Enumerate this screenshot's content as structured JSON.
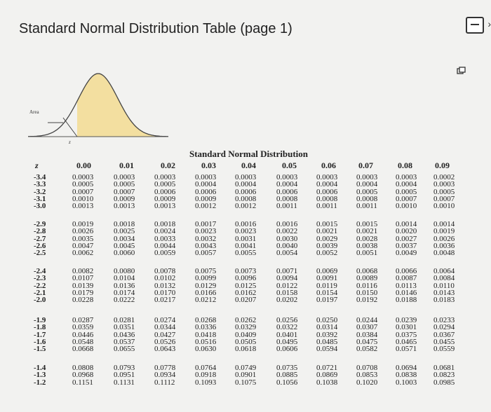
{
  "title": "Standard Normal Distribution Table (page 1)",
  "figure": {
    "area_label": "Area",
    "z_label": "z"
  },
  "table": {
    "title": "Standard Normal Distribution",
    "z_header": "z",
    "columns": [
      "0.00",
      "0.01",
      "0.02",
      "0.03",
      "0.04",
      "0.05",
      "0.06",
      "0.07",
      "0.08",
      "0.09"
    ],
    "groups": [
      {
        "z": [
          "-3.4",
          "-3.3",
          "-3.2",
          "-3.1",
          "-3.0"
        ],
        "cols": [
          [
            "0.0003",
            "0.0005",
            "0.0007",
            "0.0010",
            "0.0013"
          ],
          [
            "0.0003",
            "0.0005",
            "0.0007",
            "0.0009",
            "0.0013"
          ],
          [
            "0.0003",
            "0.0005",
            "0.0006",
            "0.0009",
            "0.0013"
          ],
          [
            "0.0003",
            "0.0004",
            "0.0006",
            "0.0009",
            "0.0012"
          ],
          [
            "0.0003",
            "0.0004",
            "0.0006",
            "0.0008",
            "0.0012"
          ],
          [
            "0.0003",
            "0.0004",
            "0.0006",
            "0.0008",
            "0.0011"
          ],
          [
            "0.0003",
            "0.0004",
            "0.0006",
            "0.0008",
            "0.0011"
          ],
          [
            "0.0003",
            "0.0004",
            "0.0005",
            "0.0008",
            "0.0011"
          ],
          [
            "0.0003",
            "0.0004",
            "0.0005",
            "0.0007",
            "0.0010"
          ],
          [
            "0.0002",
            "0.0003",
            "0.0005",
            "0.0007",
            "0.0010"
          ]
        ]
      },
      {
        "z": [
          "-2.9",
          "-2.8",
          "-2.7",
          "-2.6",
          "-2.5"
        ],
        "cols": [
          [
            "0.0019",
            "0.0026",
            "0.0035",
            "0.0047",
            "0.0062"
          ],
          [
            "0.0018",
            "0.0025",
            "0.0034",
            "0.0045",
            "0.0060"
          ],
          [
            "0.0018",
            "0.0024",
            "0.0033",
            "0.0044",
            "0.0059"
          ],
          [
            "0.0017",
            "0.0023",
            "0.0032",
            "0.0043",
            "0.0057"
          ],
          [
            "0.0016",
            "0.0023",
            "0.0031",
            "0.0041",
            "0.0055"
          ],
          [
            "0.0016",
            "0.0022",
            "0.0030",
            "0.0040",
            "0.0054"
          ],
          [
            "0.0015",
            "0.0021",
            "0.0029",
            "0.0039",
            "0.0052"
          ],
          [
            "0.0015",
            "0.0021",
            "0.0028",
            "0.0038",
            "0.0051"
          ],
          [
            "0.0014",
            "0.0020",
            "0.0027",
            "0.0037",
            "0.0049"
          ],
          [
            "0.0014",
            "0.0019",
            "0.0026",
            "0.0036",
            "0.0048"
          ]
        ]
      },
      {
        "z": [
          "-2.4",
          "-2.3",
          "-2.2",
          "-2.1",
          "-2.0"
        ],
        "cols": [
          [
            "0.0082",
            "0.0107",
            "0.0139",
            "0.0179",
            "0.0228"
          ],
          [
            "0.0080",
            "0.0104",
            "0.0136",
            "0.0174",
            "0.0222"
          ],
          [
            "0.0078",
            "0.0102",
            "0.0132",
            "0.0170",
            "0.0217"
          ],
          [
            "0.0075",
            "0.0099",
            "0.0129",
            "0.0166",
            "0.0212"
          ],
          [
            "0.0073",
            "0.0096",
            "0.0125",
            "0.0162",
            "0.0207"
          ],
          [
            "0.0071",
            "0.0094",
            "0.0122",
            "0.0158",
            "0.0202"
          ],
          [
            "0.0069",
            "0.0091",
            "0.0119",
            "0.0154",
            "0.0197"
          ],
          [
            "0.0068",
            "0.0089",
            "0.0116",
            "0.0150",
            "0.0192"
          ],
          [
            "0.0066",
            "0.0087",
            "0.0113",
            "0.0146",
            "0.0188"
          ],
          [
            "0.0064",
            "0.0084",
            "0.0110",
            "0.0143",
            "0.0183"
          ]
        ]
      },
      {
        "z": [
          "-1.9",
          "-1.8",
          "-1.7",
          "-1.6",
          "-1.5"
        ],
        "cols": [
          [
            "0.0287",
            "0.0359",
            "0.0446",
            "0.0548",
            "0.0668"
          ],
          [
            "0.0281",
            "0.0351",
            "0.0436",
            "0.0537",
            "0.0655"
          ],
          [
            "0.0274",
            "0.0344",
            "0.0427",
            "0.0526",
            "0.0643"
          ],
          [
            "0.0268",
            "0.0336",
            "0.0418",
            "0.0516",
            "0.0630"
          ],
          [
            "0.0262",
            "0.0329",
            "0.0409",
            "0.0505",
            "0.0618"
          ],
          [
            "0.0256",
            "0.0322",
            "0.0401",
            "0.0495",
            "0.0606"
          ],
          [
            "0.0250",
            "0.0314",
            "0.0392",
            "0.0485",
            "0.0594"
          ],
          [
            "0.0244",
            "0.0307",
            "0.0384",
            "0.0475",
            "0.0582"
          ],
          [
            "0.0239",
            "0.0301",
            "0.0375",
            "0.0465",
            "0.0571"
          ],
          [
            "0.0233",
            "0.0294",
            "0.0367",
            "0.0455",
            "0.0559"
          ]
        ]
      },
      {
        "z": [
          "-1.4",
          "-1.3",
          "-1.2"
        ],
        "cols": [
          [
            "0.0808",
            "0.0968",
            "0.1151"
          ],
          [
            "0.0793",
            "0.0951",
            "0.1131"
          ],
          [
            "0.0778",
            "0.0934",
            "0.1112"
          ],
          [
            "0.0764",
            "0.0918",
            "0.1093"
          ],
          [
            "0.0749",
            "0.0901",
            "0.1075"
          ],
          [
            "0.0735",
            "0.0885",
            "0.1056"
          ],
          [
            "0.0721",
            "0.0869",
            "0.1038"
          ],
          [
            "0.0708",
            "0.0853",
            "0.1020"
          ],
          [
            "0.0694",
            "0.0838",
            "0.1003"
          ],
          [
            "0.0681",
            "0.0823",
            "0.0985"
          ]
        ]
      }
    ]
  },
  "colors": {
    "curve_fill": "#f3dfa0",
    "curve_stroke": "#444444"
  },
  "icons": {
    "collapse": "minus-box-icon",
    "copy": "copy-icon",
    "next": "chevron-right-icon"
  }
}
